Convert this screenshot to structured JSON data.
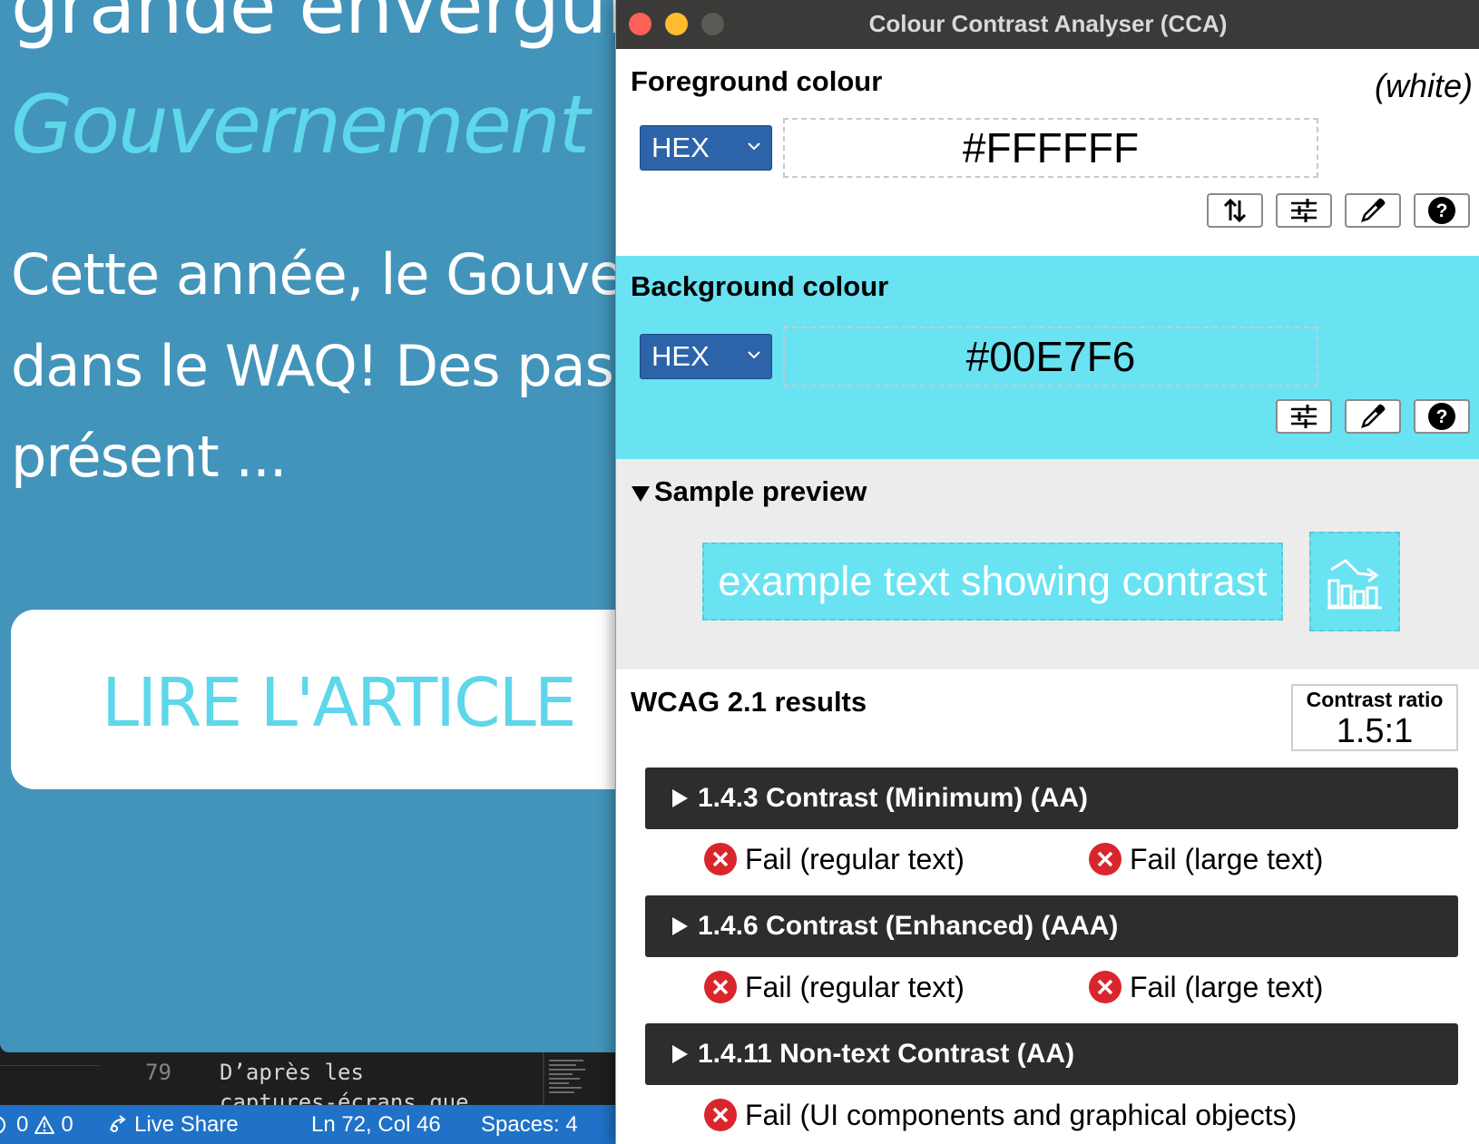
{
  "webpage": {
    "heading": "grande envergure",
    "subheading": "Gouvernement du Québec",
    "paragraph_lines": [
      "Cette année, le Gouvernement",
      "dans le WAQ! Des passionnés",
      "présent ..."
    ],
    "button_label": "LIRE L'ARTICLE"
  },
  "editor": {
    "line_number": "79",
    "code_lines": [
      "D’après les",
      "captures-écrans que"
    ]
  },
  "statusbar": {
    "problems_errors": "0",
    "problems_warnings": "0",
    "live_share": "Live Share",
    "position": "Ln 72, Col 46",
    "spaces": "Spaces: 4"
  },
  "cca": {
    "title": "Colour Contrast Analyser (CCA)",
    "foreground": {
      "label": "Foreground colour",
      "colour_name": "(white)",
      "format": "HEX",
      "value": "#FFFFFF",
      "color": "#FFFFFF"
    },
    "background": {
      "label": "Background colour",
      "format": "HEX",
      "value": "#00E7F6",
      "color": "#69E2F2"
    },
    "preview": {
      "label": "Sample preview",
      "sample_text": "example text showing contrast"
    },
    "results": {
      "label": "WCAG 2.1 results",
      "ratio_label": "Contrast ratio",
      "ratio_value": "1.5:1",
      "criteria": [
        {
          "title": "1.4.3 Contrast (Minimum) (AA)",
          "results": [
            "Fail (regular text)",
            "Fail (large text)"
          ]
        },
        {
          "title": "1.4.6 Contrast (Enhanced) (AAA)",
          "results": [
            "Fail (regular text)",
            "Fail (large text)"
          ]
        },
        {
          "title": "1.4.11 Non-text Contrast (AA)",
          "results": [
            "Fail (UI components and graphical objects)"
          ]
        }
      ]
    },
    "colors": {
      "titlebar": "#3B3A38",
      "select_blue": "#2C63A9",
      "criterion_bar": "#2D2D2D",
      "fail_red": "#D9262C"
    }
  }
}
